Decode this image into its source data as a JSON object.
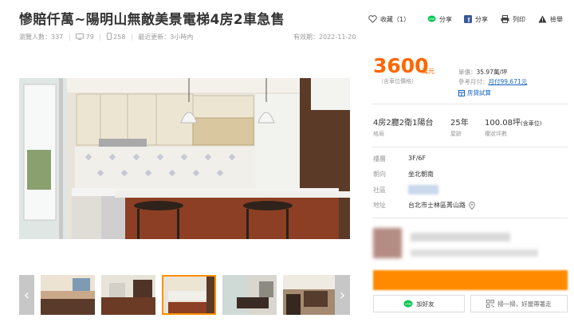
{
  "header": {
    "title": "慘賠仟萬~陽明山無敵美景電梯4房2車急售",
    "views": "瀏覽人數：337",
    "comments": "79",
    "mobile_views": "258",
    "updated": "最近更新：3小時內",
    "expiry": "有效期：2022-11-20"
  },
  "actions": {
    "favorite": "收藏（1）",
    "line_share": "分享",
    "fb_share": "分享",
    "print": "列印",
    "report": "檢舉"
  },
  "price": {
    "amount": "3600",
    "unit": "萬元",
    "note": "（含車位價格）",
    "unit_price_label": "單價：",
    "unit_price_value": "35.97萬/坪",
    "monthly_label": "參考月付：",
    "monthly_value": "月付99,671元",
    "calc_label": "房貸試算"
  },
  "specs": {
    "layout_value": "4房2廳2衛1陽台",
    "layout_label": "格局",
    "age_value": "25年",
    "age_label": "屋齡",
    "area_value": "100.08坪",
    "area_suffix": "(含車位)",
    "area_label": "權狀坪數"
  },
  "details": {
    "floor_label": "樓層",
    "floor_value": "3F/6F",
    "facing_label": "朝向",
    "facing_value": "坐北朝南",
    "community_label": "社區",
    "address_label": "地址",
    "address_value": "台北市士林區菁山路"
  },
  "contact": {
    "line_button": "加好友",
    "qr_button": "掃一掃，好屋帶著走"
  },
  "colors": {
    "accent": "#ff6600",
    "phone_bar": "#ff8a00",
    "link": "#1565c0",
    "line_green": "#06c755",
    "fb_blue": "#3b5998"
  },
  "icons": {
    "favorite": "heart-icon",
    "line": "line-icon",
    "facebook": "facebook-icon",
    "print": "printer-icon",
    "report": "warning-icon",
    "comments": "monitor-icon",
    "mobile": "phone-icon",
    "location": "map-pin-icon",
    "calc": "calculator-icon",
    "qr": "qr-code-icon"
  }
}
